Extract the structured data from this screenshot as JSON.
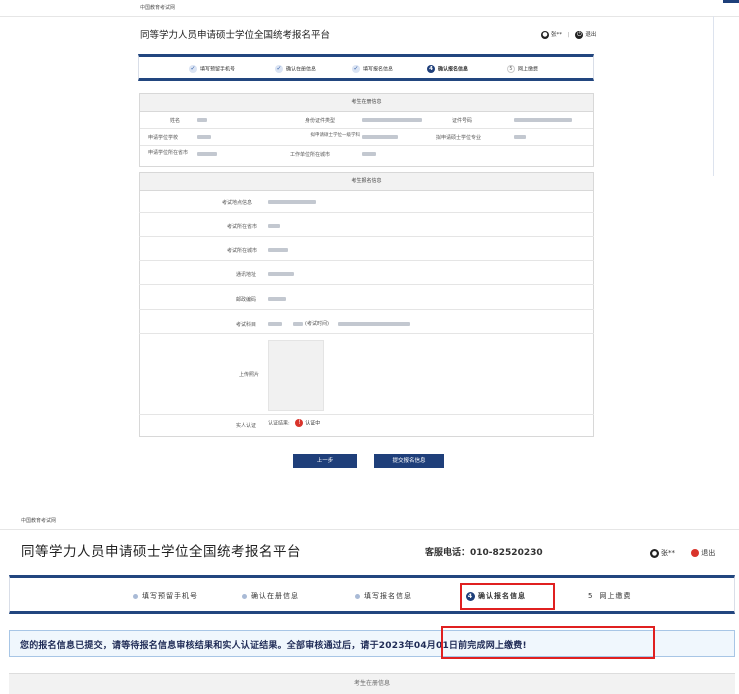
{
  "top": {
    "brand": "中国教育考试网",
    "title": "同等学力人员申请硕士学位全国统考报名平台",
    "user_label": "张**",
    "logout_label": "退出",
    "steps": [
      "填写预留手机号",
      "确认在册信息",
      "填写报名信息",
      "确认报名信息",
      "网上缴费"
    ],
    "step_numbers": [
      "4",
      "5"
    ],
    "reg_section_title": "考生在册信息",
    "reg_labels": {
      "name": "姓名",
      "id_type": "身份证件类型",
      "id_no": "证件号码",
      "school": "申请学位学校",
      "category": "拟申请硕士学位一级学科",
      "major": "拟申请硕士学位专业",
      "school_province": "申请学位所在省市",
      "work_city": "工作单位所在城市"
    },
    "apply_section_title": "考生报名信息",
    "apply_labels": {
      "exam_site": "考试地点信息",
      "exam_province": "考试所在省市",
      "exam_city": "考试所在城市",
      "address": "通讯地址",
      "postcode": "邮政编码",
      "subject": "考试科目",
      "subject_value": "(考试时间)",
      "photo": "上传照片",
      "real_name": "实人认证"
    },
    "verify_result_label": "认证结果:",
    "verify_status": "认证中",
    "prev_button": "上一步",
    "submit_button": "提交报名信息"
  },
  "bottom": {
    "brand": "中国教育考试网",
    "title": "同等学力人员申请硕士学位全国统考报名平台",
    "hotline": "客服电话：010-82520230",
    "user_label": "张**",
    "logout_label": "退出",
    "steps": [
      "填写预留手机号",
      "确认在册信息",
      "填写报名信息",
      "确认报名信息",
      "网上缴费"
    ],
    "active_step_number": "4",
    "last_step_number": "5",
    "notice": "您的报名信息已提交，请等待报名信息审核结果和实人认证结果。全部审核通过后，请于2023年04月01日前完成网上缴费!",
    "next_section_title": "考生在册信息"
  },
  "colors": {
    "navy": "#1f3f7a",
    "highlight": "#e02020",
    "notice_bg": "#f0f7fd"
  }
}
